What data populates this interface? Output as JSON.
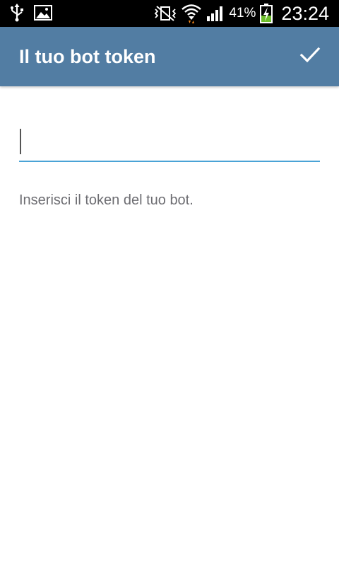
{
  "status_bar": {
    "icons_left": [
      "usb-icon",
      "image-notification-icon"
    ],
    "icons_right": [
      "vibrate-mute-icon",
      "wifi-icon",
      "signal-icon",
      "battery-charging-icon"
    ],
    "battery_percent": "41%",
    "time": "23:24",
    "battery_level": 0.41
  },
  "action_bar": {
    "title": "Il tuo bot token",
    "done_icon": "check-icon",
    "background_color": "#527da3"
  },
  "content": {
    "token_input": {
      "value": "",
      "placeholder": ""
    },
    "helper_text": "Inserisci il token del tuo bot.",
    "accent_color": "#4aa3d6"
  }
}
